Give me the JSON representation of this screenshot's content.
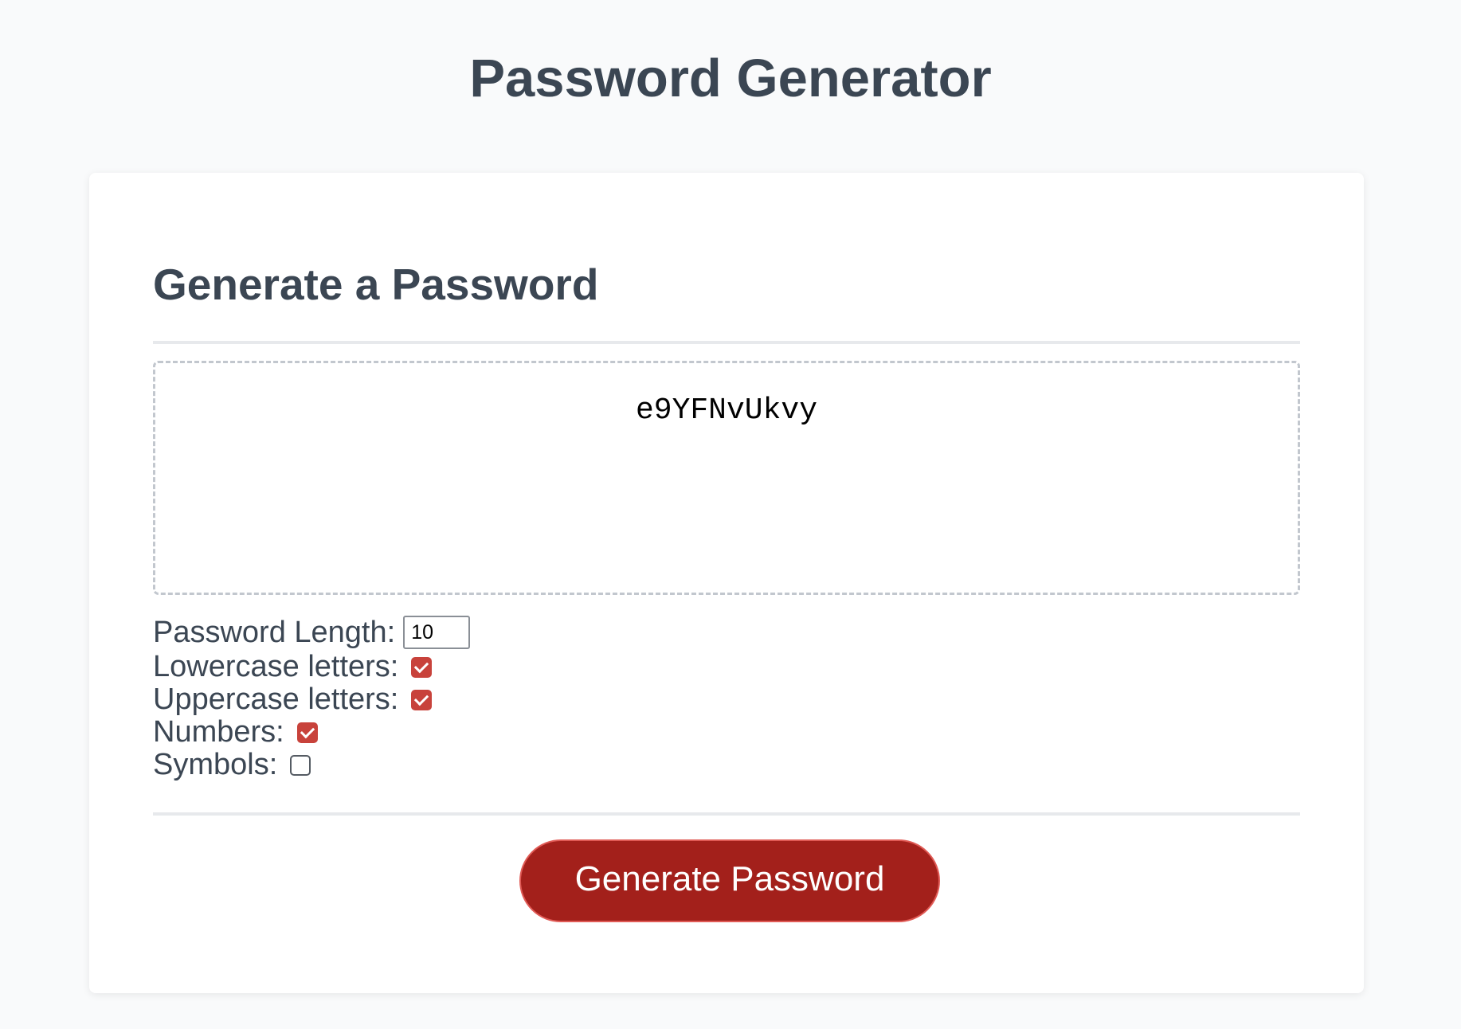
{
  "page": {
    "title": "Password Generator"
  },
  "card": {
    "header": "Generate a Password",
    "password": "e9YFNvUkvy",
    "options": {
      "length_label": "Password Length:",
      "length_value": "10",
      "lowercase_label": "Lowercase letters:",
      "lowercase_checked": true,
      "uppercase_label": "Uppercase letters:",
      "uppercase_checked": true,
      "numbers_label": "Numbers:",
      "numbers_checked": true,
      "symbols_label": "Symbols:",
      "symbols_checked": false
    },
    "button_label": "Generate Password"
  },
  "colors": {
    "accent": "#a3201b",
    "checkbox": "#c8423b",
    "text": "#3b4653",
    "background": "#f9fafb"
  }
}
